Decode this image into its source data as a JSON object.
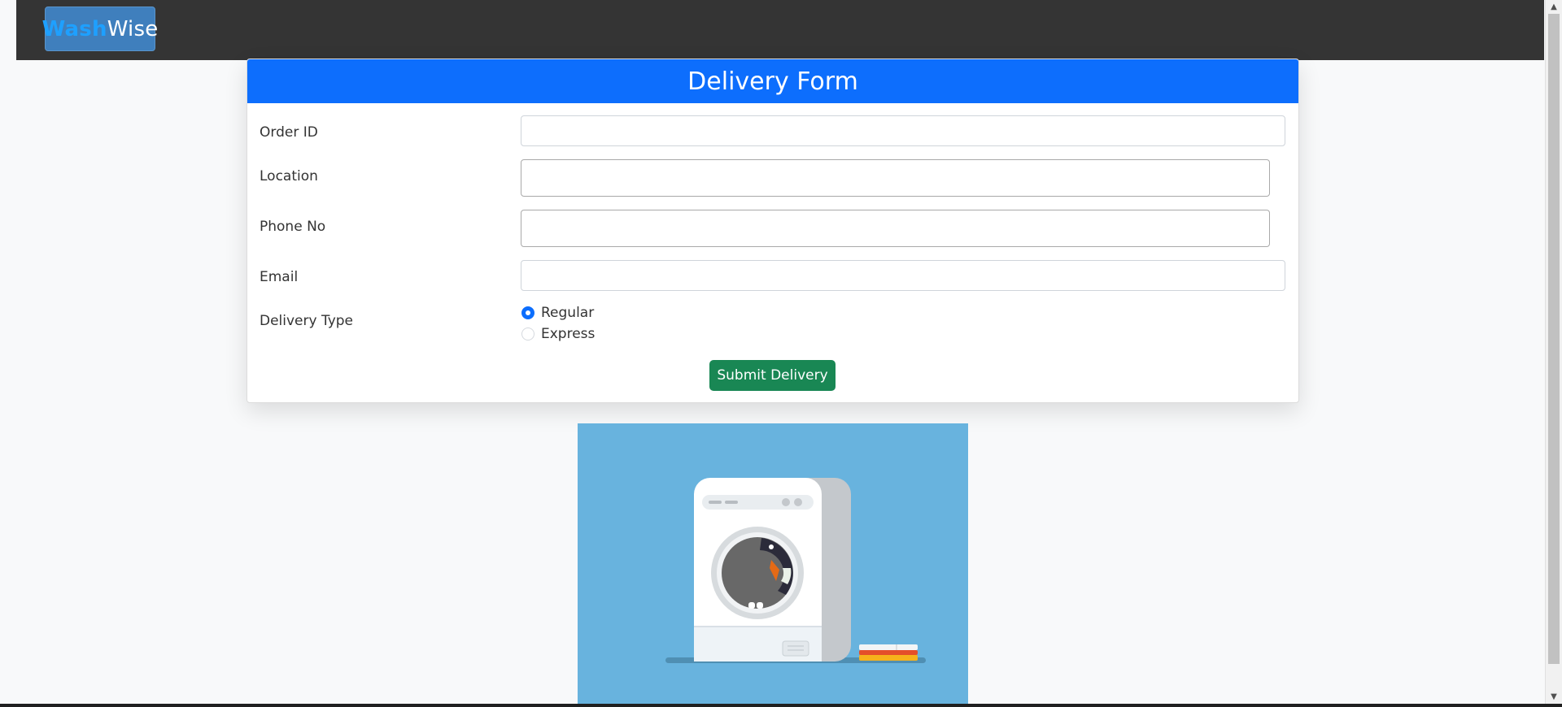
{
  "brand": {
    "part1": "Wash",
    "part2": "Wise",
    "part1_color": "#1ea0ff",
    "part2_color": "#ffffff"
  },
  "form": {
    "title": "Delivery Form",
    "fields": {
      "order_id": {
        "label": "Order ID",
        "value": ""
      },
      "location": {
        "label": "Location",
        "value": ""
      },
      "phone": {
        "label": "Phone No",
        "value": ""
      },
      "email": {
        "label": "Email",
        "value": ""
      }
    },
    "delivery_type": {
      "label": "Delivery Type",
      "options": [
        {
          "label": "Regular",
          "selected": true
        },
        {
          "label": "Express",
          "selected": false
        }
      ]
    },
    "submit_label": "Submit Delivery"
  },
  "colors": {
    "navbar": "#343434",
    "header": "#0d6efd",
    "submit": "#198754",
    "illustration_bg": "#68b3de"
  },
  "illustration": {
    "icon": "washing-machine-illustration"
  }
}
